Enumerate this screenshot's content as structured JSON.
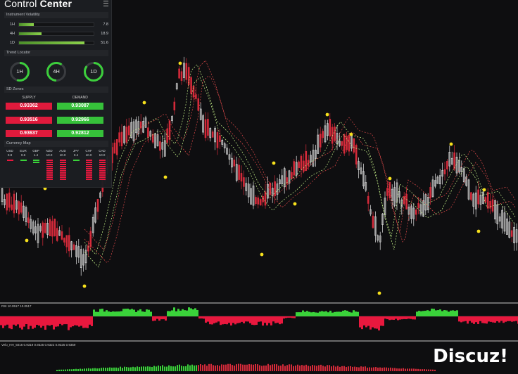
{
  "control_center": {
    "title_light": "Control",
    "title_bold": "Center",
    "volatility": {
      "header": "Instrument Volatility",
      "rows": [
        {
          "label": "1H",
          "value": "7.8",
          "fill_pct": 20
        },
        {
          "label": "4H",
          "value": "18.9",
          "fill_pct": 30
        },
        {
          "label": "1D",
          "value": "51.6",
          "fill_pct": 88
        }
      ]
    },
    "trend_locator": {
      "header": "Trend Locator",
      "gauges": [
        {
          "label": "1H",
          "level": 0.55
        },
        {
          "label": "4H",
          "level": 0.6
        },
        {
          "label": "1D",
          "level": 0.85
        }
      ]
    },
    "sd_zones": {
      "header": "SD Zones",
      "supply_label": "SUPPLY",
      "demand_label": "DEMAND",
      "supply": [
        "0.93362",
        "0.93516",
        "0.93637"
      ],
      "demand": [
        "0.93087",
        "0.92966",
        "0.92812"
      ]
    },
    "currency_map": {
      "header": "Currency Map",
      "currencies": [
        {
          "code": "USD",
          "value": "0.8"
        },
        {
          "code": "EUR",
          "value": "0.6"
        },
        {
          "code": "GBP",
          "value": "1.4"
        },
        {
          "code": "NZD",
          "value": "10.0"
        },
        {
          "code": "AUD",
          "value": "10.0"
        },
        {
          "code": "JPY",
          "value": "0.4"
        },
        {
          "code": "CHF",
          "value": "10.0"
        },
        {
          "code": "CAD",
          "value": "10.0"
        }
      ]
    }
  },
  "indicators": {
    "rsi_label": "RSI 10.0517 10.0517",
    "sub2_label": "Velo_HH_5016 0.9319 0.9325 0.9322 0.9325 0.9359"
  },
  "watermark": "Discuz!",
  "colors": {
    "bull": "#e6e6e6",
    "bear": "#d42a3a",
    "dot": "#f7e11c",
    "green": "#3ad23a",
    "red": "#e8183e"
  }
}
